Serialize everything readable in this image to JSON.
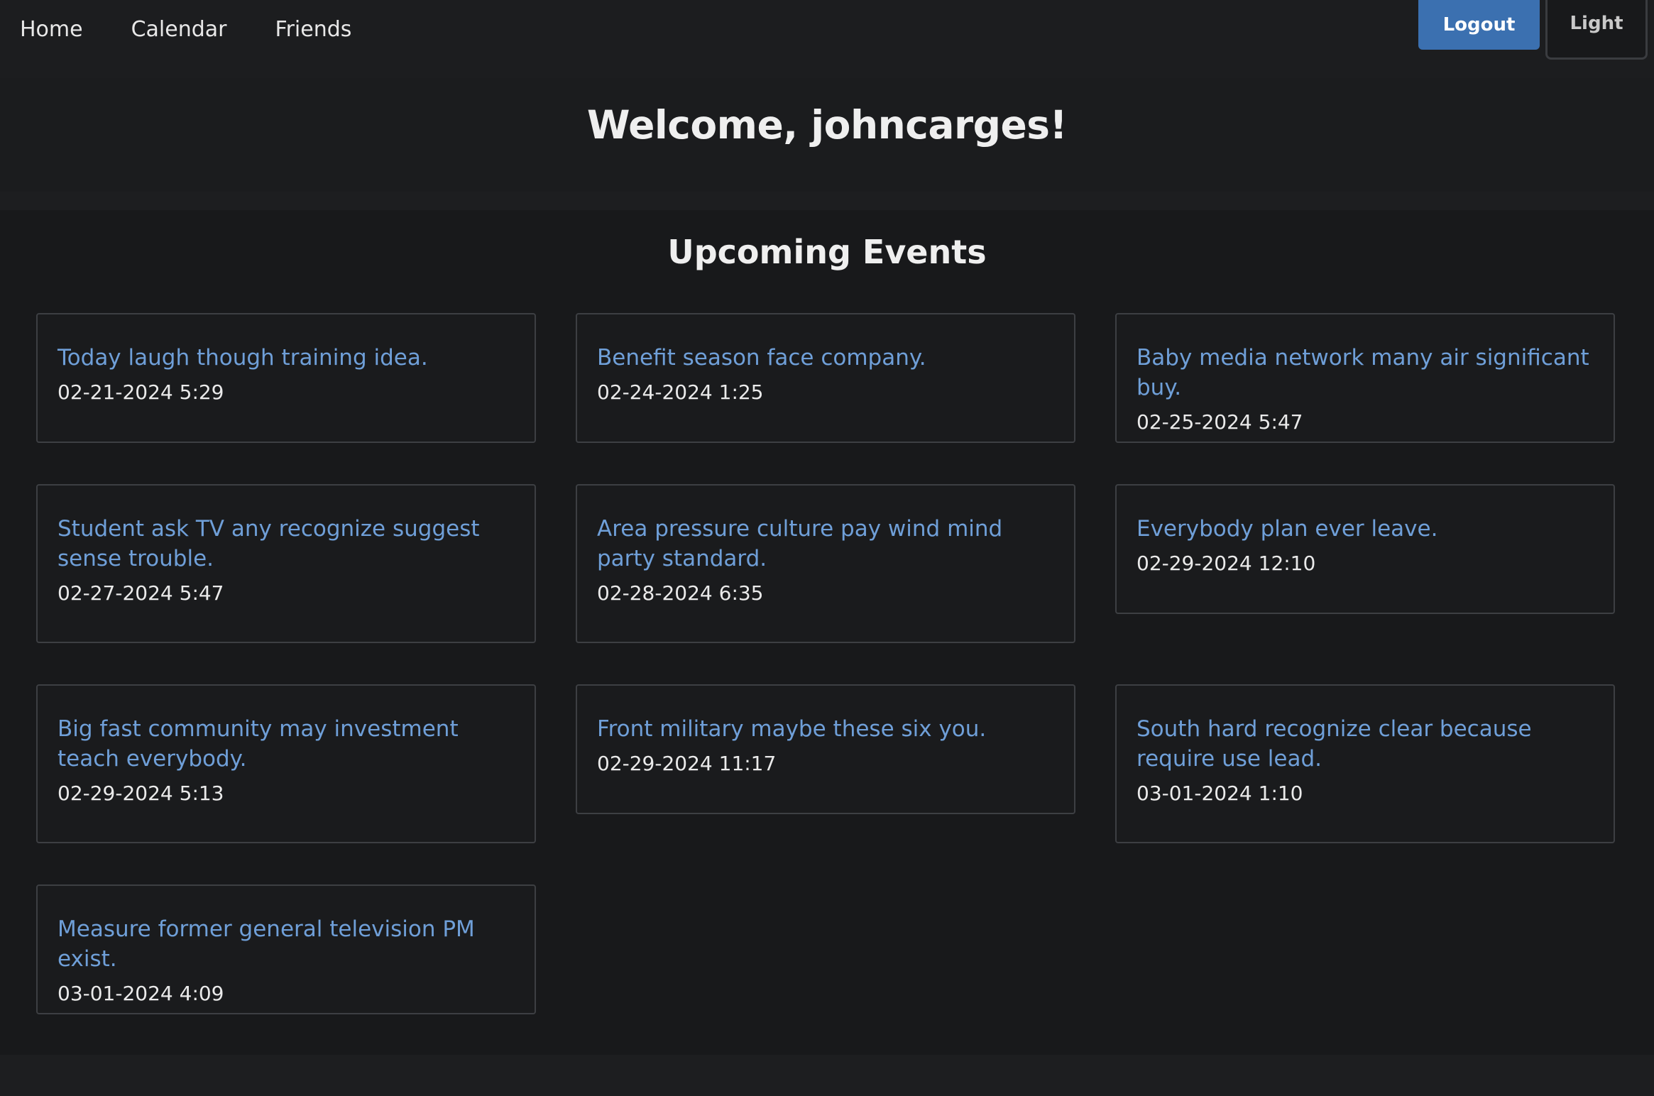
{
  "nav": {
    "links": [
      "Home",
      "Calendar",
      "Friends"
    ],
    "logout_label": "Logout",
    "theme_label": "Light"
  },
  "hero": {
    "welcome": "Welcome, johncarges!"
  },
  "events": {
    "heading": "Upcoming Events",
    "items": [
      {
        "title": "Today laugh though training idea.",
        "date": "02-21-2024 5:29"
      },
      {
        "title": "Benefit season face company.",
        "date": "02-24-2024 1:25"
      },
      {
        "title": "Baby media network many air significant buy.",
        "date": "02-25-2024 5:47"
      },
      {
        "title": "Student ask TV any recognize suggest sense trouble.",
        "date": "02-27-2024 5:47"
      },
      {
        "title": "Area pressure culture pay wind mind party standard.",
        "date": "02-28-2024 6:35"
      },
      {
        "title": "Everybody plan ever leave.",
        "date": "02-29-2024 12:10"
      },
      {
        "title": "Big fast community may investment teach everybody.",
        "date": "02-29-2024 5:13"
      },
      {
        "title": "Front military maybe these six you.",
        "date": "02-29-2024 11:17"
      },
      {
        "title": "South hard recognize clear because require use lead.",
        "date": "03-01-2024 1:10"
      },
      {
        "title": "Measure former general television PM exist.",
        "date": "03-01-2024 4:09"
      }
    ]
  },
  "colors": {
    "accent": "#3b70b0",
    "link": "#6f9fd8",
    "background": "#18191b"
  }
}
